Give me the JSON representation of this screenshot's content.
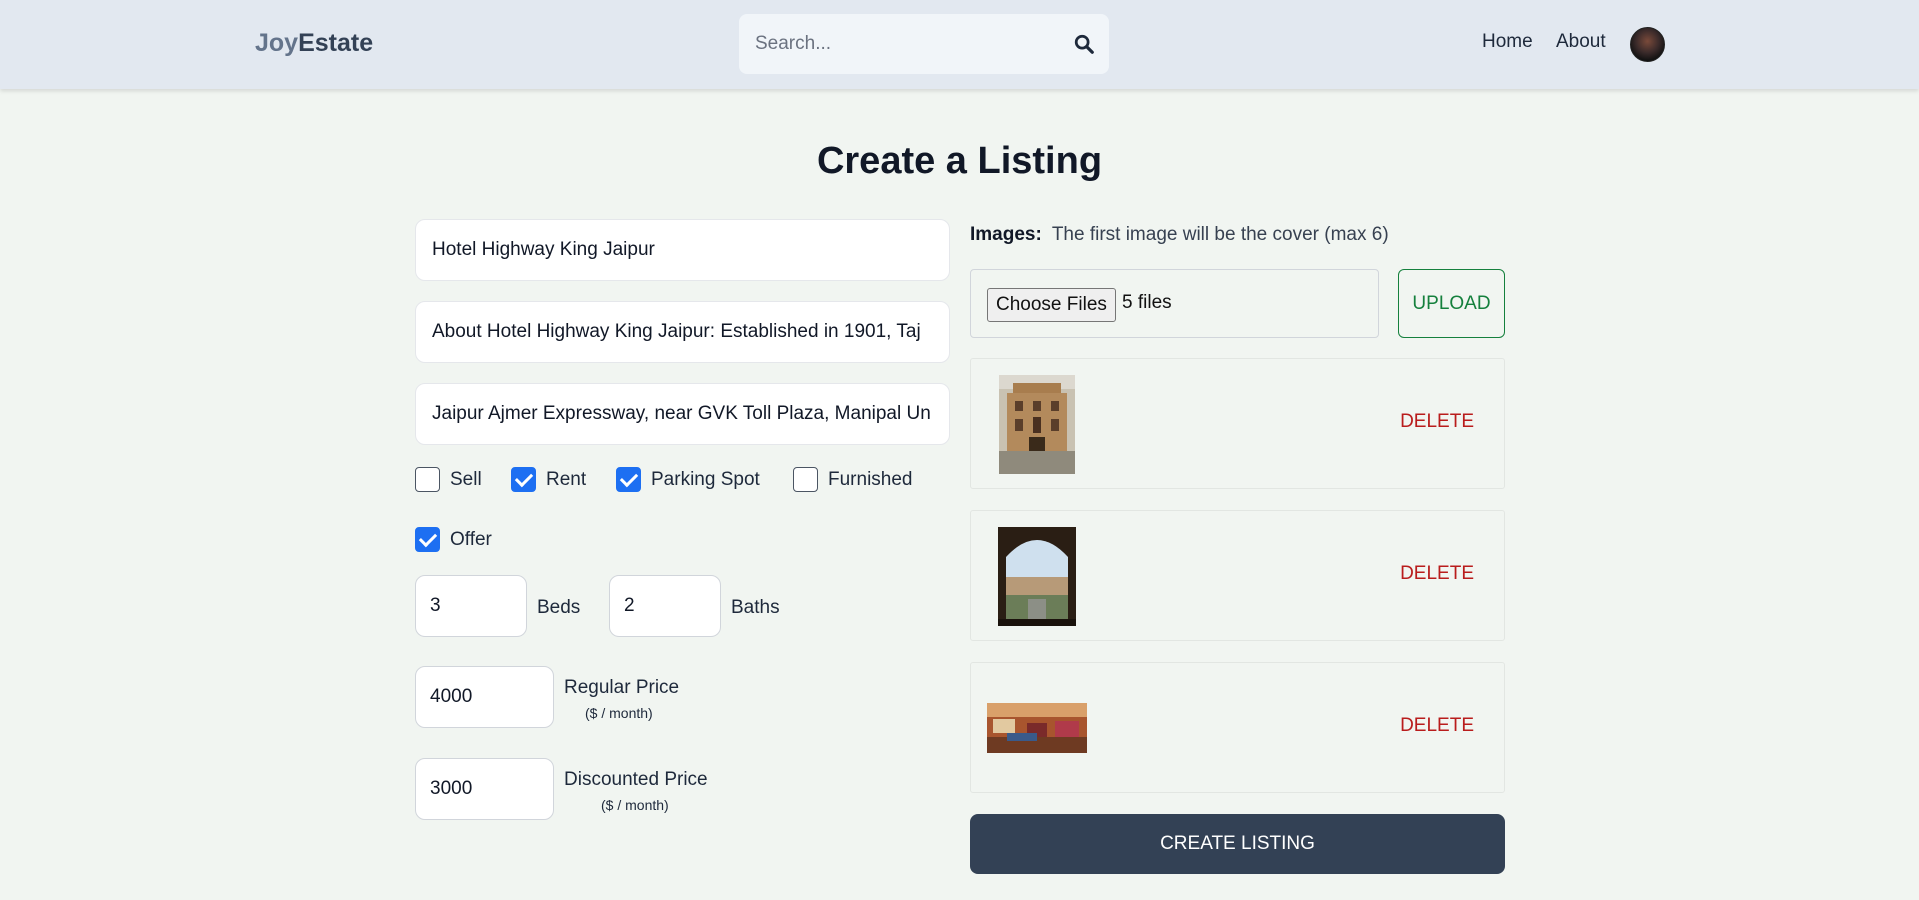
{
  "header": {
    "logo_part1": "Joy",
    "logo_part2": "Estate",
    "search_placeholder": "Search...",
    "nav": [
      "Home",
      "About"
    ]
  },
  "page": {
    "title": "Create a Listing"
  },
  "form": {
    "name": "Hotel Highway King Jaipur",
    "description": "About Hotel Highway King Jaipur: Established in 1901, Taj",
    "address": "Jaipur Ajmer Expressway, near GVK Toll Plaza, Manipal Un",
    "checkboxes": [
      {
        "label": "Sell",
        "checked": false
      },
      {
        "label": "Rent",
        "checked": true
      },
      {
        "label": "Parking Spot",
        "checked": true
      },
      {
        "label": "Furnished",
        "checked": false
      },
      {
        "label": "Offer",
        "checked": true
      }
    ],
    "beds": {
      "value": "3",
      "label": "Beds"
    },
    "baths": {
      "value": "2",
      "label": "Baths"
    },
    "regular_price": {
      "value": "4000",
      "label": "Regular Price",
      "unit": "($ / month)"
    },
    "discounted_price": {
      "value": "3000",
      "label": "Discounted Price",
      "unit": "($ / month)"
    }
  },
  "images": {
    "label": "Images:",
    "hint": "The first image will be the cover (max 6)",
    "choose_label": "Choose Files",
    "file_count": "5 files",
    "upload_label": "UPLOAD",
    "delete_label": "DELETE"
  },
  "submit_label": "CREATE LISTING",
  "colors": {
    "header_bg": "#e2e8f0",
    "page_bg": "#f1f5f1",
    "checkbox_accent": "#1d6ff2",
    "upload_green": "#15803d",
    "delete_red": "#b91c1c",
    "primary_button": "#334155"
  }
}
